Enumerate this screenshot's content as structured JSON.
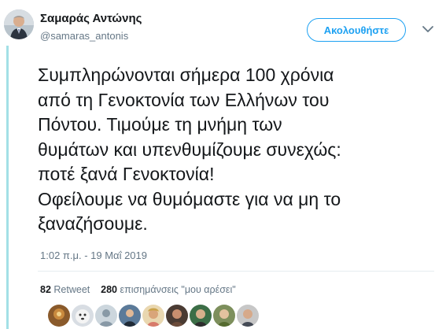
{
  "author": {
    "name": "Σαμαράς Αντώνης",
    "handle": "@samaras_antonis",
    "avatar_icon": "profile-photo"
  },
  "header": {
    "follow_label": "Ακολουθήστε",
    "menu_icon": "chevron-down-icon"
  },
  "tweet": {
    "lines": [
      "Συμπληρώνονται σήμερα 100 χρόνια",
      "από τη Γενοκτονία των Ελλήνων του",
      "Πόντου. Τιμούμε τη μνήμη των",
      "θυμάτων και υπενθυμίζουμε συνεχώς:",
      "ποτέ ξανά Γενοκτονία!",
      "Οφείλουμε να θυμόμαστε για να μη το",
      "ξαναζήσουμε."
    ],
    "timestamp": "1:02 π.μ. - 19 Μαΐ 2019"
  },
  "stats": {
    "retweet_count": "82",
    "retweet_label": "Retweet",
    "like_count": "280",
    "like_label": "επισημάνσεις \"μου αρέσει\""
  },
  "colors": {
    "accent": "#1da1f2",
    "thread_line": "#a3e0e6",
    "muted": "#657786"
  }
}
